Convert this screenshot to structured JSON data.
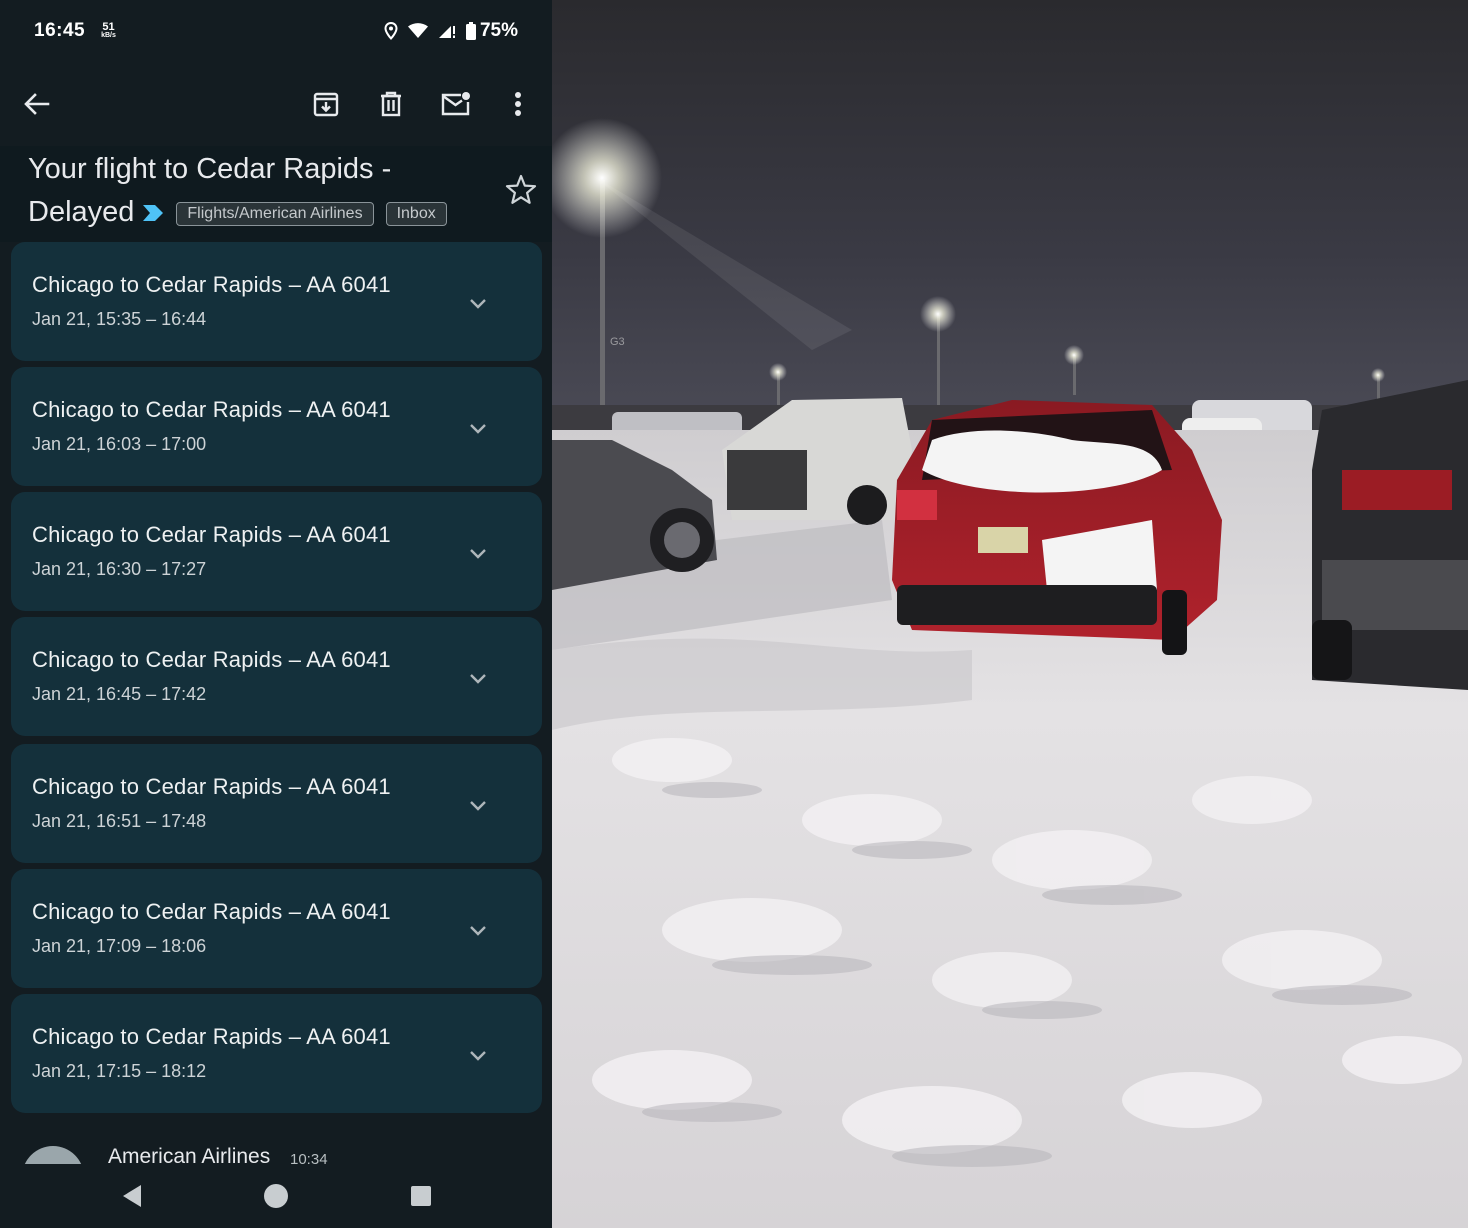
{
  "status_bar": {
    "time": "16:45",
    "net_rate": "51",
    "net_rate_unit": "kB/s",
    "battery": "75%"
  },
  "toolbar": {
    "icons": [
      "back-arrow-icon",
      "archive-icon",
      "delete-icon",
      "mark-unread-icon",
      "more-vert-icon"
    ]
  },
  "email": {
    "subject_line1": "Your flight to Cedar Rapids -",
    "subject_line2": "Delayed",
    "labels": [
      "Flights/American Airlines",
      "Inbox"
    ],
    "importance_color": "#4fc3f7"
  },
  "cards": [
    {
      "title": "Chicago to Cedar Rapids – AA 6041",
      "when": "Jan 21, 15:35 – 16:44"
    },
    {
      "title": "Chicago to Cedar Rapids – AA 6041",
      "when": "Jan 21, 16:03 – 17:00"
    },
    {
      "title": "Chicago to Cedar Rapids – AA 6041",
      "when": "Jan 21, 16:30 – 17:27"
    },
    {
      "title": "Chicago to Cedar Rapids – AA 6041",
      "when": "Jan 21, 16:45 – 17:42"
    },
    {
      "title": "Chicago to Cedar Rapids – AA 6041",
      "when": "Jan 21, 16:51 – 17:48"
    },
    {
      "title": "Chicago to Cedar Rapids – AA 6041",
      "when": "Jan 21, 17:09 – 18:06"
    },
    {
      "title": "Chicago to Cedar Rapids – AA 6041",
      "when": "Jan 21, 17:15 – 18:12"
    }
  ],
  "message": {
    "sender": "American Airlines",
    "time": "10:34"
  },
  "photo": {
    "pole_sign": "G3"
  }
}
